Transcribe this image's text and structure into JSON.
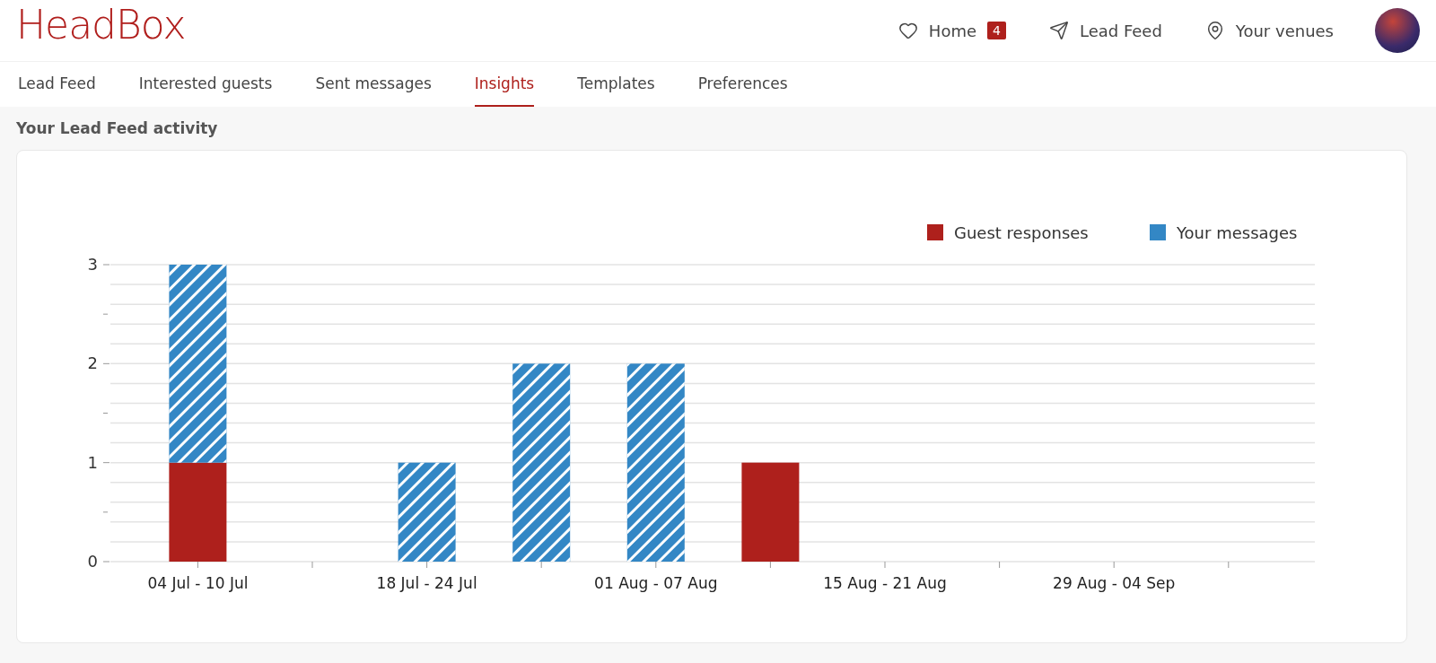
{
  "logo": "HeadBox",
  "nav": [
    {
      "kind": "heart",
      "label": "Home",
      "badge": "4"
    },
    {
      "kind": "send",
      "label": "Lead Feed"
    },
    {
      "kind": "pin",
      "label": "Your venues"
    }
  ],
  "tabs": [
    {
      "label": "Lead Feed",
      "selected": false
    },
    {
      "label": "Interested guests",
      "selected": false
    },
    {
      "label": "Sent messages",
      "selected": false
    },
    {
      "label": "Insights",
      "selected": true
    },
    {
      "label": "Templates",
      "selected": false
    },
    {
      "label": "Preferences",
      "selected": false
    }
  ],
  "section_title": "Your Lead Feed activity",
  "chart_data": {
    "type": "bar",
    "stacked": true,
    "categories": [
      "04 Jul - 10 Jul",
      null,
      "18 Jul - 24 Jul",
      null,
      "01 Aug - 07 Aug",
      null,
      "15 Aug - 21 Aug",
      null,
      "29 Aug - 04 Sep",
      null
    ],
    "series": [
      {
        "name": "Guest responses",
        "color": "#ae201c",
        "values": [
          1,
          0,
          0,
          0,
          0,
          1,
          0,
          0,
          0,
          0
        ]
      },
      {
        "name": "Your messages",
        "color": "#3387c5",
        "values": [
          2,
          0,
          1,
          2,
          2,
          0,
          0,
          0,
          0,
          0
        ]
      }
    ],
    "ylim": [
      0,
      3
    ],
    "yticks": [
      0,
      1,
      2,
      3
    ],
    "legend": "top-right"
  }
}
